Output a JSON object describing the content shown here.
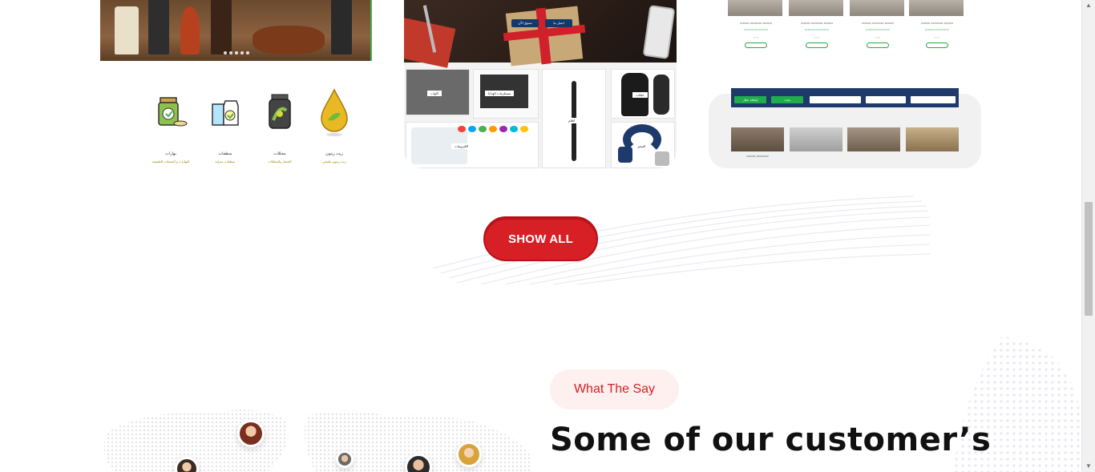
{
  "show_all": {
    "label": "SHOW ALL"
  },
  "testimonials": {
    "pill": "What The Say",
    "heading": "Some of our customer’s"
  },
  "card1": {
    "categories": [
      {
        "name": "بهارات",
        "sub": "البهارات و المنتجات الطبيعية",
        "icon": "spice-jar-icon"
      },
      {
        "name": "منظفات",
        "sub": "منظفات منزلية",
        "icon": "detergent-bottles-icon"
      },
      {
        "name": "مخللات",
        "sub": "الخضار والمخللات",
        "icon": "pickles-jar-icon"
      },
      {
        "name": "زيت زيتون",
        "sub": "زيت زيتون طبيعي",
        "icon": "olive-oil-drop-icon"
      }
    ]
  },
  "card2": {
    "buttons": [
      "تسوق الآن",
      "اتصل بنا"
    ],
    "tiles": [
      "أكواب",
      "مستلزمات الهدايا",
      "أقلام",
      "حقائب",
      "الكترونيات",
      "السفر"
    ]
  },
  "card3": {
    "filter_button": "بحث",
    "secondary_button": "إضافة عقار"
  },
  "colors": {
    "accent": "#d71f26",
    "pill_bg": "#fdf0ef",
    "nav_blue": "#1e3a6b",
    "green": "#1fae4b"
  }
}
